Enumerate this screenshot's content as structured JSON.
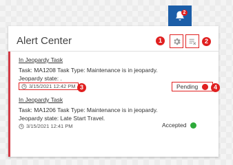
{
  "header": {
    "title": "Alert Center",
    "bell_badge": "2"
  },
  "markers": [
    "1",
    "2",
    "3",
    "4"
  ],
  "alerts": [
    {
      "link": "In Jeopardy Task",
      "line1": "Task: MA1208 Task Type: Maintenance is in jeopardy.",
      "line2": "Jeopardy state: .",
      "timestamp": "3/15/2021 12:42 PM",
      "status": "Pending",
      "status_color": "#e02020"
    },
    {
      "link": "In Jeopardy Task",
      "line1": "Task: MA1206 Task Type: Maintenance is in jeopardy.",
      "line2": "Jeopardy state: Late Start Travel.",
      "timestamp": "3/15/2021 12:41 PM",
      "status": "Accepted",
      "status_color": "#2eaa3a"
    }
  ],
  "colors": {
    "accent": "#1c5ea8",
    "alert_bar": "#d23a45",
    "annotation": "#e02020"
  }
}
